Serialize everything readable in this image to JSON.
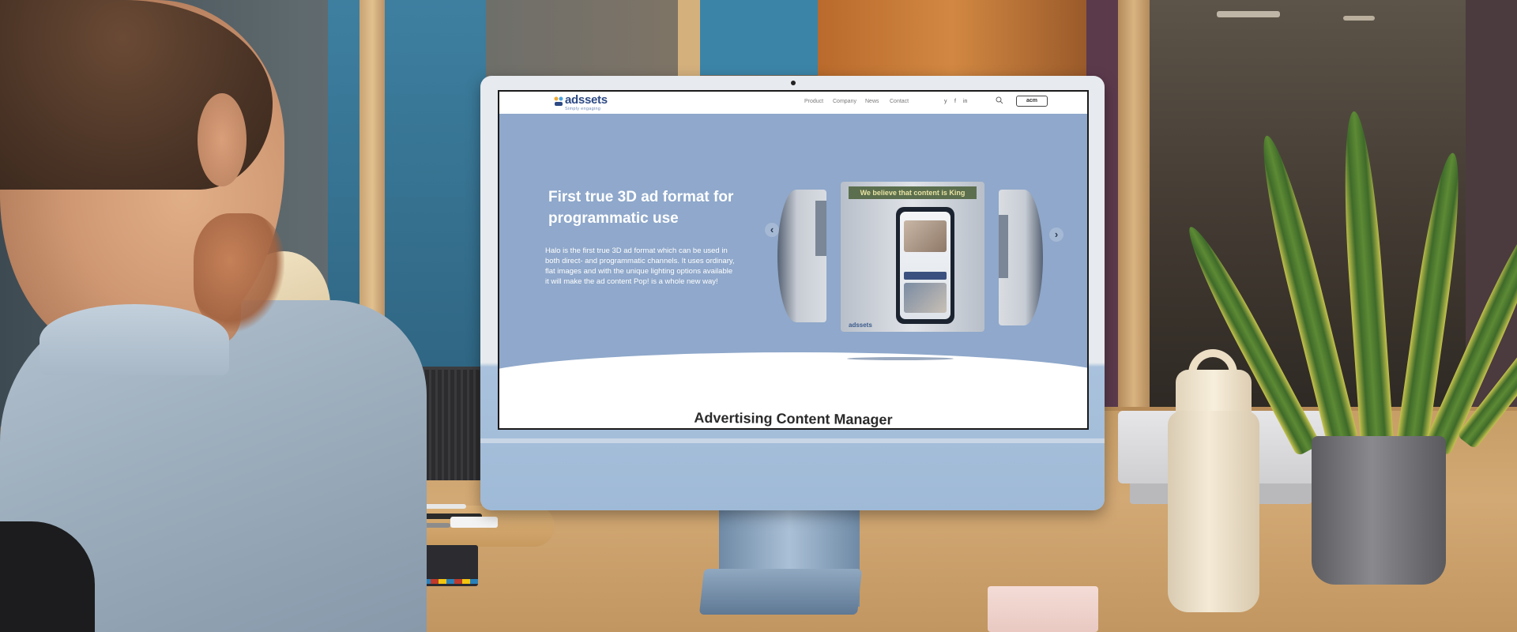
{
  "site": {
    "logo": {
      "name": "adssets",
      "tagline": "Simply engaging"
    },
    "nav": {
      "links": [
        "Product",
        "Company",
        "News",
        "Contact"
      ],
      "social": [
        "y",
        "f",
        "in"
      ],
      "cta": "acm"
    },
    "hero": {
      "title": "First true 3D ad format for programmatic use",
      "body": "Halo is the first true 3D ad format which can be used in both direct- and programmatic channels. It uses ordinary, flat images and with the unique lighting options available it will make the ad content Pop! is a whole new way!",
      "carousel": {
        "banner": "We believe that content is King",
        "card_logo": "adssets",
        "prev_label": "‹",
        "next_label": "›"
      }
    },
    "section_title": "Advertising Content Manager"
  },
  "icons": {
    "search": "search-icon",
    "twitter": "twitter-icon",
    "facebook": "facebook-icon",
    "linkedin": "linkedin-icon",
    "prev": "chevron-left-icon",
    "next": "chevron-right-icon"
  },
  "colors": {
    "hero_bg": "#8fa8cb",
    "brand": "#2d4a84",
    "imac_chin": "#9fbad7"
  }
}
